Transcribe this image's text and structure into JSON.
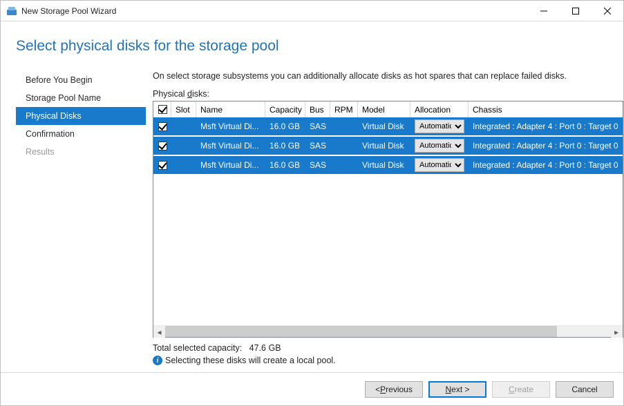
{
  "window": {
    "title": "New Storage Pool Wizard"
  },
  "page_title": "Select physical disks for the storage pool",
  "sidebar": {
    "items": [
      {
        "label": "Before You Begin",
        "state": "normal"
      },
      {
        "label": "Storage Pool Name",
        "state": "normal"
      },
      {
        "label": "Physical Disks",
        "state": "active"
      },
      {
        "label": "Confirmation",
        "state": "normal"
      },
      {
        "label": "Results",
        "state": "disabled"
      }
    ]
  },
  "main": {
    "instruction": "On select storage subsystems you can additionally allocate disks as hot spares that can replace failed disks.",
    "table_label_prefix": "Physical ",
    "table_label_ul": "d",
    "table_label_suffix": "isks:",
    "headers": {
      "slot": "Slot",
      "name": "Name",
      "capacity": "Capacity",
      "bus": "Bus",
      "rpm": "RPM",
      "model": "Model",
      "allocation": "Allocation",
      "chassis": "Chassis"
    },
    "rows": [
      {
        "checked": true,
        "slot": "",
        "name": "Msft Virtual Di...",
        "capacity": "16.0 GB",
        "bus": "SAS",
        "rpm": "",
        "model": "Virtual Disk",
        "allocation": "Automatic",
        "chassis": "Integrated : Adapter 4 : Port 0 : Target 0"
      },
      {
        "checked": true,
        "slot": "",
        "name": "Msft Virtual Di...",
        "capacity": "16.0 GB",
        "bus": "SAS",
        "rpm": "",
        "model": "Virtual Disk",
        "allocation": "Automatic",
        "chassis": "Integrated : Adapter 4 : Port 0 : Target 0"
      },
      {
        "checked": true,
        "slot": "",
        "name": "Msft Virtual Di...",
        "capacity": "16.0 GB",
        "bus": "SAS",
        "rpm": "",
        "model": "Virtual Disk",
        "allocation": "Automatic",
        "chassis": "Integrated : Adapter 4 : Port 0 : Target 0"
      }
    ],
    "total_label": "Total selected capacity:",
    "total_value": "47.6 GB",
    "info_text": "Selecting these disks will create a local pool."
  },
  "footer": {
    "previous_pre": "< ",
    "previous_ul": "P",
    "previous_post": "revious",
    "next_ul": "N",
    "next_post": "ext >",
    "create_ul": "C",
    "create_post": "reate",
    "cancel": "Cancel"
  }
}
